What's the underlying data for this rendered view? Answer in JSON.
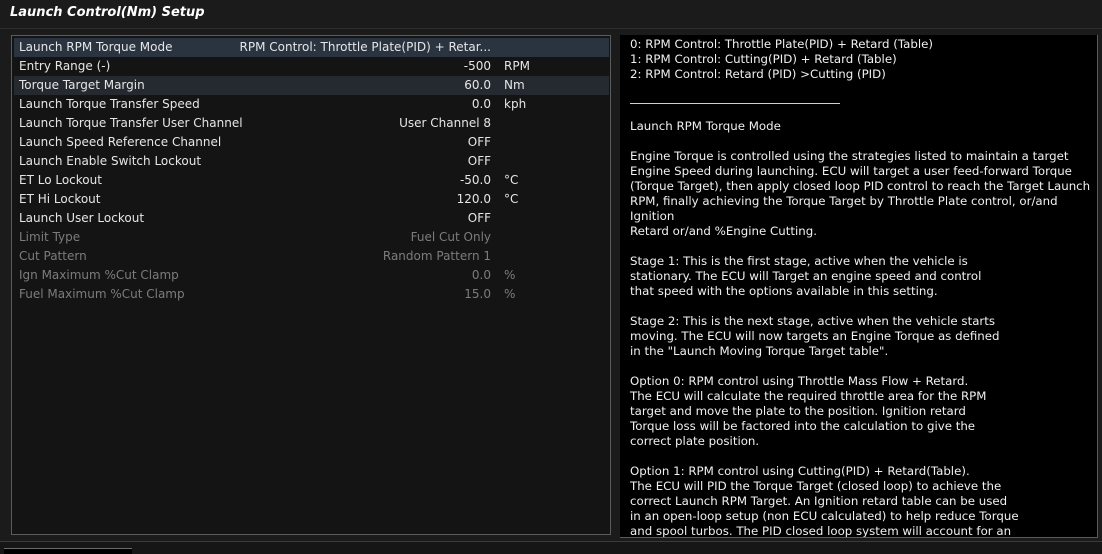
{
  "window": {
    "title": "Launch Control(Nm) Setup"
  },
  "rows": [
    {
      "label": "Launch RPM Torque Mode",
      "value": "RPM Control: Throttle Plate(PID) + Retar...",
      "unit": "",
      "state": "selected"
    },
    {
      "label": "Entry Range (-)",
      "value": "-500",
      "unit": "RPM",
      "state": "normal"
    },
    {
      "label": "Torque Target Margin",
      "value": "60.0",
      "unit": "Nm",
      "state": "highlight"
    },
    {
      "label": "Launch Torque Transfer Speed",
      "value": "0.0",
      "unit": "kph",
      "state": "normal"
    },
    {
      "label": "Launch Torque Transfer User Channel",
      "value": "User Channel 8",
      "unit": "",
      "state": "normal"
    },
    {
      "label": "Launch Speed Reference Channel",
      "value": "OFF",
      "unit": "",
      "state": "normal"
    },
    {
      "label": "Launch Enable Switch Lockout",
      "value": "OFF",
      "unit": "",
      "state": "normal"
    },
    {
      "label": "ET Lo Lockout",
      "value": "-50.0",
      "unit": "°C",
      "state": "normal"
    },
    {
      "label": "ET Hi Lockout",
      "value": "120.0",
      "unit": "°C",
      "state": "normal"
    },
    {
      "label": "Launch User Lockout",
      "value": "OFF",
      "unit": "",
      "state": "normal"
    },
    {
      "label": "Limit Type",
      "value": "Fuel Cut Only",
      "unit": "",
      "state": "disabled"
    },
    {
      "label": "Cut Pattern",
      "value": "Random Pattern 1",
      "unit": "",
      "state": "disabled"
    },
    {
      "label": "Ign Maximum %Cut Clamp",
      "value": "0.0",
      "unit": "%",
      "state": "disabled"
    },
    {
      "label": "Fuel Maximum %Cut Clamp",
      "value": "15.0",
      "unit": "%",
      "state": "disabled"
    }
  ],
  "help": {
    "options": "0: RPM Control: Throttle Plate(PID) + Retard (Table)\n1: RPM Control: Cutting(PID) + Retard (Table)\n2: RPM Control: Retard (PID) >Cutting (PID)",
    "heading": "Launch RPM Torque Mode",
    "p1": "Engine Torque is controlled using the strategies listed to maintain a target\nEngine Speed during launching.  ECU will target a user feed-forward Torque\n(Torque Target), then apply closed loop PID control to reach the Target Launch\nRPM,  finally achieving the Torque Target by Throttle Plate control, or/and Ignition\nRetard or/and %Engine Cutting.",
    "p2": "Stage 1: This is the first stage, active when the vehicle is\nstationary. The ECU will Target an engine speed and control\nthat speed with the options available in this setting.",
    "p3": "Stage 2: This is the next stage, active when the vehicle starts\nmoving. The ECU will now targets an Engine Torque as defined\nin the \"Launch Moving Torque Target table\".",
    "p4": "Option 0:  RPM control using Throttle Mass Flow + Retard.\nThe ECU will calculate the required throttle area for the RPM\ntarget and move the plate to the position. Ignition retard\nTorque loss will be factored into the calculation to give the\ncorrect plate position.",
    "p5": "Option 1: RPM control using Cutting(PID) + Retard(Table).\nThe ECU will PID the Torque Target (closed loop) to achieve the\ncorrect Launch RPM Target. An Ignition retard table can be used\nin an open-loop setup (non ECU calculated) to help reduce Torque\nand spool turbos. The PID closed loop system will account for an"
  }
}
